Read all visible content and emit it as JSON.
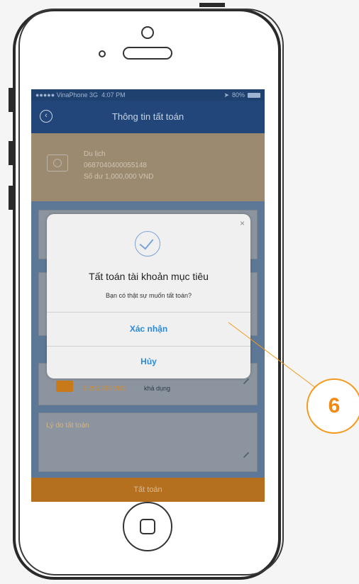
{
  "status_bar": {
    "carrier": "●●●●● VinaPhone  3G",
    "time": "4:07 PM",
    "battery": "80%"
  },
  "nav": {
    "title": "Thông tin tất toán",
    "back_icon": "chevron-left-icon"
  },
  "account": {
    "name": "Du lịch",
    "number": "0687040400055148",
    "balance": "Số dư 1,000,000 VND"
  },
  "source_account": {
    "number": "0067040600052081",
    "amount": "9,296,795 VND",
    "available_label": "khả dụng"
  },
  "reason": {
    "label": "Lý do tất toán"
  },
  "footer": {
    "button_label": "Tất toán"
  },
  "dialog": {
    "title": "Tất toán tài khoản mục tiêu",
    "message": "Bạn có thật sự muốn tất toán?",
    "confirm_label": "Xác nhận",
    "cancel_label": "Hủy",
    "close_label": "×"
  },
  "callout": {
    "number": "6"
  },
  "colors": {
    "accent": "#f39a1e",
    "nav_blue": "#224679",
    "link_blue": "#2b8ad6",
    "footer_orange": "#b5701f"
  }
}
